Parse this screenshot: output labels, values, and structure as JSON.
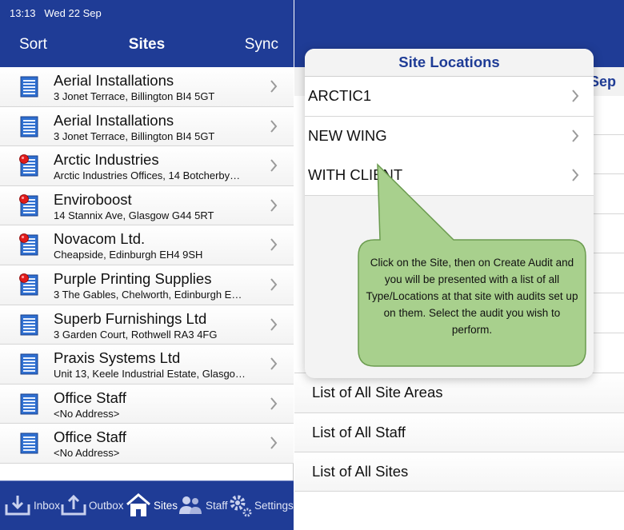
{
  "status_bar": {
    "time": "13:13",
    "date": "Wed 22 Sep"
  },
  "nav": {
    "left": "Sort",
    "title": "Sites",
    "right": "Sync"
  },
  "sites": [
    {
      "name": "Aerial Installations",
      "address": "3 Jonet Terrace, Billington BI4 5GT",
      "icon": "building-icon"
    },
    {
      "name": "Aerial Installations",
      "address": "3 Jonet Terrace, Billington BI4 5GT",
      "icon": "building-icon"
    },
    {
      "name": "Arctic Industries",
      "address": "Arctic Industries Offices, 14 Botcherby…",
      "icon": "building-flagged-icon"
    },
    {
      "name": "Enviroboost",
      "address": "14 Stannix Ave, Glasgow G44 5RT",
      "icon": "building-flagged-icon"
    },
    {
      "name": "Novacom Ltd.",
      "address": "Cheapside, Edinburgh EH4 9SH",
      "icon": "building-flagged-icon"
    },
    {
      "name": "Purple Printing Supplies",
      "address": "3 The Gables, Chelworth, Edinburgh E…",
      "icon": "building-flagged-icon"
    },
    {
      "name": "Superb Furnishings Ltd",
      "address": "3 Garden Court, Rothwell RA3 4FG",
      "icon": "building-icon"
    },
    {
      "name": "Praxis Systems Ltd",
      "address": "Unit 13, Keele Industrial Estate, Glasgo…",
      "icon": "building-icon"
    },
    {
      "name": "Office Staff",
      "address": "<No Address>",
      "icon": "building-icon"
    },
    {
      "name": "Office Staff",
      "address": "<No Address>",
      "icon": "building-icon"
    }
  ],
  "tabs": [
    {
      "label": "Inbox",
      "icon": "inbox-icon"
    },
    {
      "label": "Outbox",
      "icon": "outbox-icon"
    },
    {
      "label": "Sites",
      "icon": "home-icon"
    },
    {
      "label": "Staff",
      "icon": "staff-icon"
    },
    {
      "label": "Settings",
      "icon": "gear-icon"
    }
  ],
  "right_panel": {
    "header_fragment": "Sep",
    "items": [
      "List of All Site Areas",
      "List of All Staff",
      "List of All Sites"
    ]
  },
  "popover": {
    "title": "Site Locations",
    "items": [
      "ARCTIC1",
      "NEW WING",
      "WITH CLIENT"
    ]
  },
  "callout": {
    "text": "Click on the Site, then on Create Audit and you will be presented with a list of all Type/Locations at that site with audits set up on them.  Select the audit you wish to perform."
  },
  "colors": {
    "brand": "#1f3c96",
    "callout_fill": "#a8d08d",
    "callout_border": "#6b9b4f"
  }
}
